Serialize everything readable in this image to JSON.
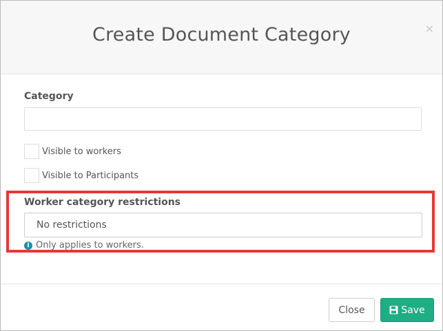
{
  "modal": {
    "title": "Create Document Category",
    "close_symbol": "×"
  },
  "form": {
    "category_label": "Category",
    "category_value": "",
    "visible_to_workers_label": "Visible to workers",
    "visible_to_workers_checked": false,
    "visible_to_participants_label": "Visible to Participants",
    "visible_to_participants_checked": false,
    "restrictions_label": "Worker category restrictions",
    "restrictions_value": "No restrictions",
    "restrictions_hint": "Only applies to workers.",
    "hint_icon": "info-icon"
  },
  "footer": {
    "close_label": "Close",
    "save_label": "Save",
    "save_icon": "floppy-disk-icon"
  },
  "colors": {
    "save_button": "#1fad84",
    "highlight_border": "#e53935",
    "info_icon": "#1e8fa3"
  }
}
